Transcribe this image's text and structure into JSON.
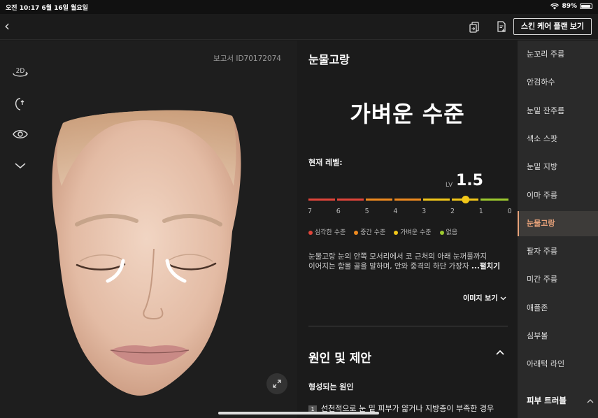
{
  "status_bar": {
    "time": "오전 10:17  6월 16일 월요일",
    "battery": "89%"
  },
  "topbar": {
    "plan_button": "스킨 케어 플랜 보기"
  },
  "left": {
    "report_id": "보고서 ID70172074",
    "tool_2d": "2D"
  },
  "detail": {
    "section_title": "눈물고랑",
    "level_text": "가벼운 수준",
    "current_label": "현재 레벨:",
    "lv_prefix": "LV",
    "lv_value": "1.5",
    "level_value": 1.5,
    "scale_numbers": [
      "7",
      "6",
      "5",
      "4",
      "3",
      "2",
      "1",
      "0"
    ],
    "legend": [
      {
        "label": "심각한 수준",
        "color": "#e0453a"
      },
      {
        "label": "중간 수준",
        "color": "#ee8a1f"
      },
      {
        "label": "가벼운 수준",
        "color": "#f2c719"
      },
      {
        "label": "없음",
        "color": "#9cc92e"
      }
    ],
    "description_line1": "눈물고랑 눈의 안쪽 모서리에서 코 근처의 아래 눈꺼풀까지",
    "description_line2": "이어지는 함몰 골을 말하며, 안와 중격의 하단 가장자 ",
    "description_more": "...펼치기",
    "image_view": "이미지 보기",
    "cause_title": "원인 및 제안",
    "cause_sub": "형성되는 원인",
    "cause_item_num": "1",
    "cause_item_text": "선천적으로 눈 밑 피부가 얇거나 지방층이 부족한 경우"
  },
  "nav": {
    "items": [
      "눈꼬리 주름",
      "안검하수",
      "눈밑 잔주름",
      "색소 스팟",
      "눈밑 지방",
      "이마 주름",
      "눈물고랑",
      "팔자 주름",
      "미간 주름",
      "애플존",
      "심부볼",
      "아래턱 라인"
    ],
    "active_index": 6,
    "group": "피부 트러블"
  },
  "colors": {
    "accent": "#e8a27a",
    "marker": "#f2c719"
  }
}
